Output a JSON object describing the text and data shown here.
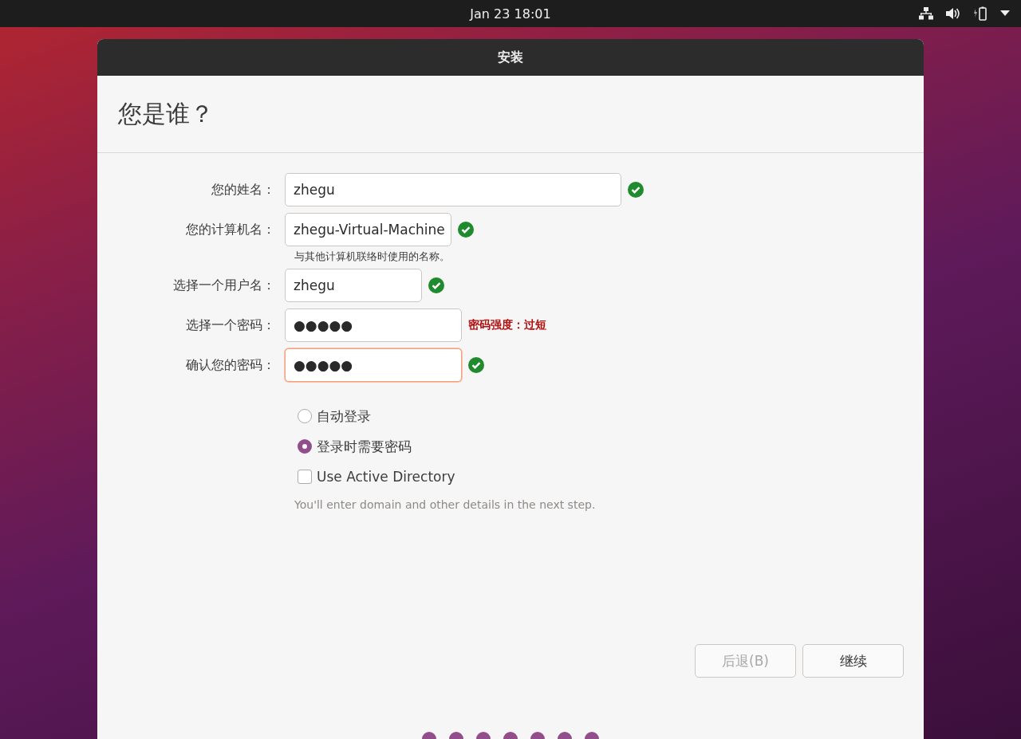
{
  "top_bar": {
    "clock": "Jan 23  18:01"
  },
  "window": {
    "title": "安装"
  },
  "page": {
    "heading": "您是谁？"
  },
  "fields": [
    {
      "label": "您的姓名：",
      "value": "zhegu",
      "focused": false,
      "status": {
        "kind": "check"
      }
    },
    {
      "label": "您的计算机名：",
      "value": "zhegu-Virtual-Machine",
      "focused": false,
      "status": {
        "kind": "check"
      },
      "hint": "与其他计算机联络时使用的名称。"
    },
    {
      "label": "选择一个用户名：",
      "value": "zhegu",
      "focused": false,
      "status": {
        "kind": "check"
      }
    },
    {
      "label": "选择一个密码：",
      "value": "●●●●●",
      "focused": false,
      "status": {
        "kind": "warning",
        "text": "密码强度：过短"
      }
    },
    {
      "label": "确认您的密码：",
      "value": "●●●●●",
      "focused": true,
      "status": {
        "kind": "check"
      }
    }
  ],
  "options": [
    {
      "kind": "radio",
      "label": "自动登录",
      "selected": false
    },
    {
      "kind": "radio",
      "label": "登录时需要密码",
      "selected": true
    },
    {
      "kind": "checkbox",
      "label": "Use Active Directory",
      "checked": false
    }
  ],
  "options_hint": "You'll enter domain and other details in the next step.",
  "buttons": [
    {
      "label": "后退(B)",
      "disabled": true
    },
    {
      "label": "继续",
      "disabled": false
    }
  ]
}
